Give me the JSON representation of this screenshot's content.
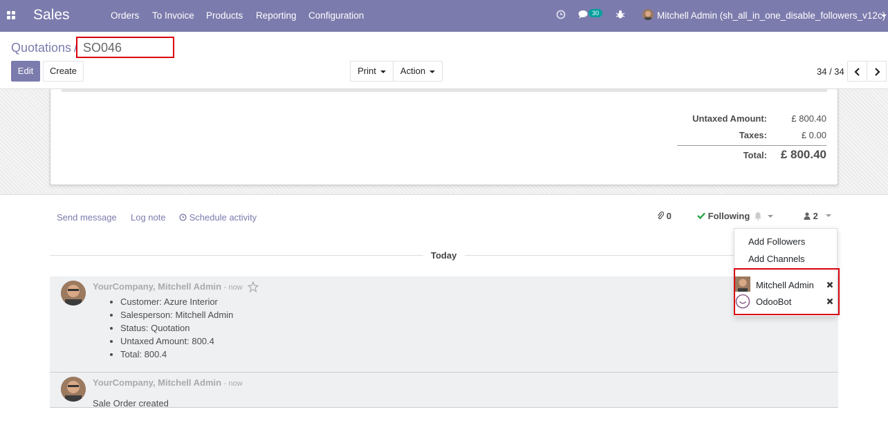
{
  "navbar": {
    "app_title": "Sales",
    "menus": [
      "Orders",
      "To Invoice",
      "Products",
      "Reporting",
      "Configuration"
    ],
    "messages_count": "30",
    "user": "Mitchell Admin (sh_all_in_one_disable_followers_v12c)",
    "icons": [
      "apps-grid-icon",
      "clock-icon",
      "chat-icon",
      "bug-icon",
      "avatar"
    ],
    "color": "#7c7bad"
  },
  "breadcrumb": {
    "parent": "Quotations",
    "separator": "/",
    "current": "SO046"
  },
  "controls": {
    "edit": "Edit",
    "create": "Create",
    "print": "Print",
    "action": "Action",
    "pager": "34 / 34"
  },
  "totals": {
    "untaxed_label": "Untaxed Amount:",
    "untaxed_value": "£ 800.40",
    "taxes_label": "Taxes:",
    "taxes_value": "£ 0.00",
    "total_label": "Total:",
    "total_value": "£ 800.40"
  },
  "chatter": {
    "send_message": "Send message",
    "log_note": "Log note",
    "schedule_activity": "Schedule activity",
    "attachments_count": "0",
    "following": "Following",
    "followers_count": "2",
    "today": "Today"
  },
  "followers_menu": {
    "add_followers": "Add Followers",
    "add_channels": "Add Channels",
    "followers": [
      {
        "name": "Mitchell Admin"
      },
      {
        "name": "OdooBot"
      }
    ]
  },
  "messages": [
    {
      "author": "YourCompany, Mitchell Admin",
      "when": "- now",
      "tracking": [
        "Customer: Azure Interior",
        "Salesperson: Mitchell Admin",
        "Status: Quotation",
        "Untaxed Amount: 800.4",
        "Total: 800.4"
      ]
    },
    {
      "author": "YourCompany, Mitchell Admin",
      "when": "- now",
      "body": "Sale Order created"
    }
  ]
}
